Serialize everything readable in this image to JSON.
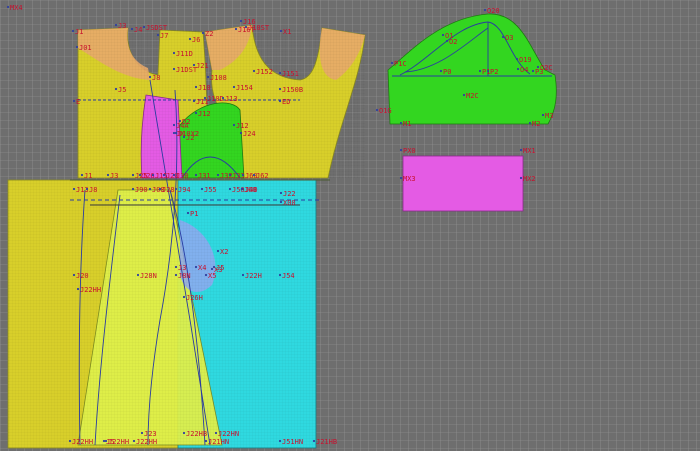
{
  "colors": {
    "background": "#6e6e6e",
    "grid": "#9a9a9a",
    "bodice": "#d8cf2a",
    "facing": "#e8a86a",
    "sleeve_panel": "#33d620",
    "skirt_front": "#2fd9e0",
    "skirt_insert": "#dff04a",
    "pocket": "#e45be4",
    "inset_blue": "#8fa8f0",
    "point_label": "#c8102e",
    "seam_line": "#2a3ca0"
  },
  "point_labels": [
    "J1",
    "J3",
    "J4",
    "JSDST",
    "J7",
    "J6",
    "Z2",
    "J16",
    "J16T",
    "J10ST",
    "X1",
    "J01",
    "J11D",
    "J1DST",
    "J21",
    "J108",
    "J151",
    "J154",
    "J152",
    "J150B",
    "J8",
    "J5",
    "J10",
    "J11",
    "J12",
    "J10D",
    "J13",
    "E",
    "ED",
    "J12",
    "J24",
    "JX",
    "J4A",
    "D2",
    "J2",
    "J10X2",
    "J1",
    "J3",
    "J25",
    "J26",
    "J15",
    "J20",
    "J30",
    "J31",
    "J32",
    "J33",
    "J60",
    "J62",
    "J22",
    "X00",
    "J13",
    "J8",
    "J90",
    "J08",
    "J94",
    "P1",
    "J40",
    "J28",
    "J55",
    "J56",
    "J60",
    "X2",
    "J3",
    "X4",
    "J5",
    "X3",
    "J22H",
    "J54",
    "J20",
    "J28N",
    "J8N",
    "X5",
    "J26H",
    "J22HH",
    "J22HH",
    "J22HH",
    "J23",
    "J5",
    "J22HH",
    "J22HB",
    "J21HN",
    "J22HN",
    "J51HN",
    "J21HB",
    "O20",
    "O1",
    "O2",
    "O3",
    "O19",
    "O4",
    "P1C",
    "P0",
    "P1",
    "P2",
    "P3",
    "O2C",
    "O1G",
    "M1",
    "M2",
    "M3",
    "M2C",
    "PX0",
    "MX1",
    "MX2",
    "MX3",
    "MX4"
  ]
}
